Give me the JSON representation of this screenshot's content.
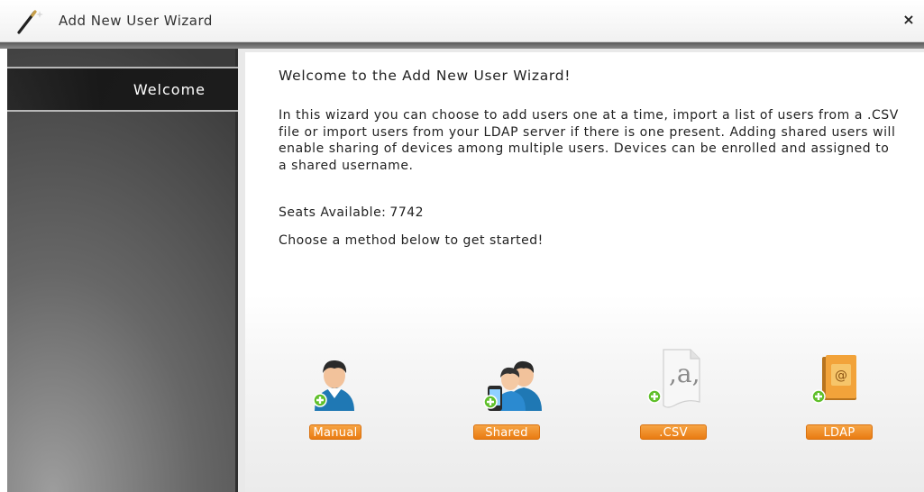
{
  "window": {
    "title": "Add New User Wizard",
    "close_glyph": "×"
  },
  "sidebar": {
    "items": [
      {
        "label": "Welcome",
        "active": true
      }
    ]
  },
  "main": {
    "heading": "Welcome to the Add New User Wizard!",
    "paragraph": "In this wizard you can choose to add users one at a time, import a list of users from a .CSV file or import users from your LDAP server if there is one present. Adding shared users will enable sharing of devices among multiple users. Devices can be enrolled and assigned to a shared username.",
    "seats_label": "Seats Available:",
    "seats_value": "7742",
    "prompt": "Choose a method below to get started!"
  },
  "methods": [
    {
      "label": "Manual",
      "icon": "user-add-icon"
    },
    {
      "label": "Shared",
      "icon": "shared-users-add-icon"
    },
    {
      "label": ".CSV",
      "icon": "csv-file-add-icon"
    },
    {
      "label": "LDAP",
      "icon": "address-book-add-icon"
    }
  ],
  "colors": {
    "accent_orange": "#ef8a1f",
    "plus_green": "#5fbf2a",
    "user_blue": "#1f78b4",
    "sidebar_dark": "#3b3b3b"
  }
}
